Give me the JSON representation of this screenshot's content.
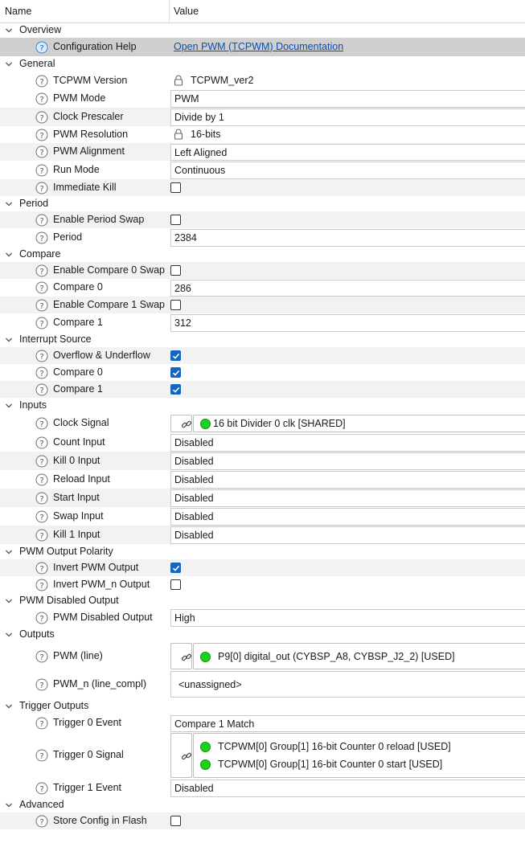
{
  "header": {
    "name": "Name",
    "value": "Value"
  },
  "overview": {
    "label": "Overview",
    "config_help": {
      "name": "Configuration Help",
      "link": "Open PWM (TCPWM) Documentation"
    }
  },
  "general": {
    "label": "General",
    "tcpwm_version": {
      "name": "TCPWM Version",
      "value": "TCPWM_ver2"
    },
    "pwm_mode": {
      "name": "PWM Mode",
      "value": "PWM"
    },
    "clock_prescaler": {
      "name": "Clock Prescaler",
      "value": "Divide by 1"
    },
    "pwm_resolution": {
      "name": "PWM Resolution",
      "value": "16-bits"
    },
    "pwm_alignment": {
      "name": "PWM Alignment",
      "value": "Left Aligned"
    },
    "run_mode": {
      "name": "Run Mode",
      "value": "Continuous"
    },
    "immediate_kill": {
      "name": "Immediate Kill",
      "checked": false
    }
  },
  "period": {
    "label": "Period",
    "enable_period_swap": {
      "name": "Enable Period Swap",
      "checked": false
    },
    "period": {
      "name": "Period",
      "value": "2384"
    }
  },
  "compare": {
    "label": "Compare",
    "enable_compare0_swap": {
      "name": "Enable Compare 0 Swap",
      "checked": false
    },
    "compare0": {
      "name": "Compare 0",
      "value": "286"
    },
    "enable_compare1_swap": {
      "name": "Enable Compare 1 Swap",
      "checked": false
    },
    "compare1": {
      "name": "Compare 1",
      "value": "312"
    }
  },
  "interrupt_source": {
    "label": "Interrupt Source",
    "overflow_underflow": {
      "name": "Overflow & Underflow",
      "checked": true
    },
    "compare0": {
      "name": "Compare 0",
      "checked": true
    },
    "compare1": {
      "name": "Compare 1",
      "checked": true
    }
  },
  "inputs": {
    "label": "Inputs",
    "clock_signal": {
      "name": "Clock Signal",
      "value": "16 bit Divider 0 clk [SHARED]"
    },
    "count_input": {
      "name": "Count Input",
      "value": "Disabled"
    },
    "kill0_input": {
      "name": "Kill 0 Input",
      "value": "Disabled"
    },
    "reload_input": {
      "name": "Reload Input",
      "value": "Disabled"
    },
    "start_input": {
      "name": "Start Input",
      "value": "Disabled"
    },
    "swap_input": {
      "name": "Swap Input",
      "value": "Disabled"
    },
    "kill1_input": {
      "name": "Kill 1 Input",
      "value": "Disabled"
    }
  },
  "pwm_output_polarity": {
    "label": "PWM Output Polarity",
    "invert_pwm_output": {
      "name": "Invert PWM Output",
      "checked": true
    },
    "invert_pwm_n_output": {
      "name": "Invert PWM_n Output",
      "checked": false
    }
  },
  "pwm_disabled_output": {
    "label": "PWM Disabled Output",
    "pwm_disabled_output": {
      "name": "PWM Disabled Output",
      "value": "High"
    }
  },
  "outputs": {
    "label": "Outputs",
    "pwm_line": {
      "name": "PWM (line)",
      "value": "P9[0] digital_out (CYBSP_A8, CYBSP_J2_2) [USED]"
    },
    "pwm_n_line_compl": {
      "name": "PWM_n (line_compl)",
      "value": "<unassigned>"
    }
  },
  "trigger_outputs": {
    "label": "Trigger Outputs",
    "trigger0_event": {
      "name": "Trigger 0 Event",
      "value": "Compare 1 Match"
    },
    "trigger0_signal": {
      "name": "Trigger 0 Signal",
      "values": [
        "TCPWM[0] Group[1] 16-bit Counter 0 reload [USED]",
        "TCPWM[0] Group[1] 16-bit Counter 0 start [USED]"
      ]
    },
    "trigger1_event": {
      "name": "Trigger 1 Event",
      "value": "Disabled"
    }
  },
  "advanced": {
    "label": "Advanced",
    "store_config_in_flash": {
      "name": "Store Config in Flash",
      "checked": false
    }
  },
  "colors": {
    "accent": "#1565c0",
    "link": "#0b4fb5",
    "status_used": "#19d219",
    "row_alt": "#f2f2f2",
    "row_selected": "#cfcfcf"
  },
  "icons": {
    "section_toggle": "chevron-down-icon",
    "help": "help-circle-icon",
    "locked": "lock-icon",
    "link": "link-icon",
    "status": "status-dot-icon"
  }
}
